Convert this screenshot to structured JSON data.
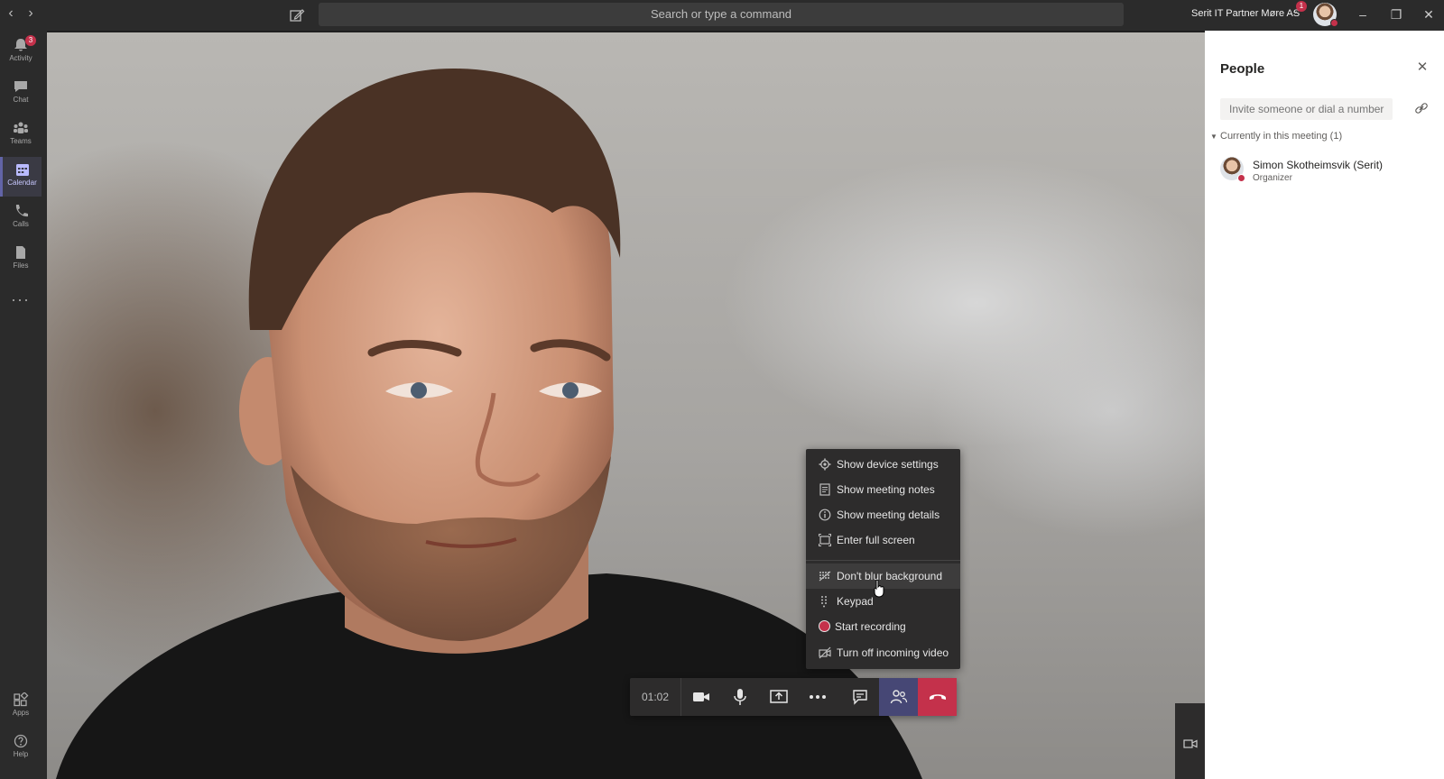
{
  "titlebar": {
    "back_icon": "chevron-left-icon",
    "forward_icon": "chevron-right-icon",
    "compose_icon": "compose-icon",
    "search_placeholder": "Search or type a command",
    "tenant_name": "Serit IT Partner Møre AS",
    "tenant_badge": "1",
    "window_buttons": [
      "minimize",
      "restore",
      "close"
    ]
  },
  "rail": {
    "items": [
      {
        "label": "Activity",
        "icon": "bell-icon",
        "badge": "3"
      },
      {
        "label": "Chat",
        "icon": "chat-icon"
      },
      {
        "label": "Teams",
        "icon": "teams-icon"
      },
      {
        "label": "Calendar",
        "icon": "calendar-icon",
        "active": true
      },
      {
        "label": "Calls",
        "icon": "phone-icon"
      },
      {
        "label": "Files",
        "icon": "files-icon"
      }
    ],
    "more_label": "···",
    "bottom": [
      {
        "label": "Apps",
        "icon": "apps-icon"
      },
      {
        "label": "Help",
        "icon": "help-icon"
      }
    ]
  },
  "menu": {
    "items": [
      {
        "label": "Show device settings",
        "icon": "gear-icon"
      },
      {
        "label": "Show meeting notes",
        "icon": "notes-icon"
      },
      {
        "label": "Show meeting details",
        "icon": "info-icon"
      },
      {
        "label": "Enter full screen",
        "icon": "fullscreen-icon"
      },
      {
        "label": "Don't blur background",
        "icon": "blur-icon",
        "hovered": true
      },
      {
        "label": "Keypad",
        "icon": "keypad-icon"
      },
      {
        "label": "Start recording",
        "icon": "record-icon"
      },
      {
        "label": "Turn off incoming video",
        "icon": "video-off-icon"
      }
    ]
  },
  "controls": {
    "timer": "01:02",
    "buttons": [
      "camera",
      "microphone",
      "share",
      "more-options",
      "conversation",
      "participants",
      "hang-up"
    ]
  },
  "people_panel": {
    "title": "People",
    "invite_placeholder": "Invite someone or dial a number",
    "section_label": "Currently in this meeting (1)",
    "participants": [
      {
        "name": "Simon Skotheimsvik (Serit)",
        "role": "Organizer",
        "status": "busy"
      }
    ]
  },
  "colors": {
    "accent": "#6264a7",
    "hangup": "#c4314b",
    "dark_surface": "#2d2c2c"
  }
}
